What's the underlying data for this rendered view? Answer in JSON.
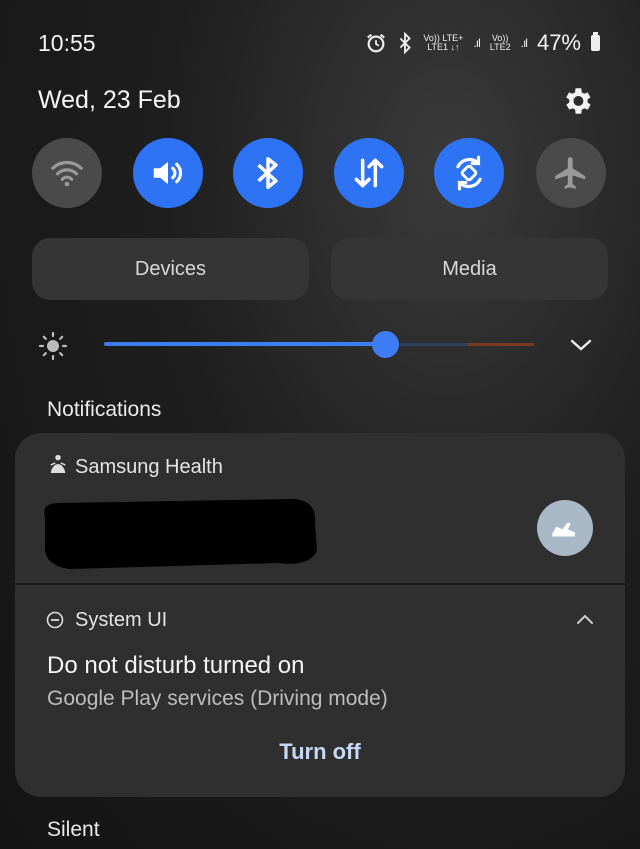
{
  "status_bar": {
    "time": "10:55",
    "sim1_top": "Vo)) LTE+",
    "sim1_bottom": "LTE1 ↓↑",
    "sim2_top": "Vo))",
    "sim2_bottom": "LTE2",
    "battery_percent": "47%",
    "icons": [
      "alarm-icon",
      "bluetooth-icon",
      "signal-icon",
      "battery-icon"
    ]
  },
  "header": {
    "date": "Wed, 23 Feb",
    "settings_icon": "gear-icon"
  },
  "quick_tiles": [
    {
      "name": "wifi",
      "icon": "wifi-icon",
      "state": "off"
    },
    {
      "name": "sound",
      "icon": "speaker-icon",
      "state": "on"
    },
    {
      "name": "bluetooth",
      "icon": "bluetooth-icon",
      "state": "on"
    },
    {
      "name": "mobile-data",
      "icon": "data-arrows-icon",
      "state": "on"
    },
    {
      "name": "auto-rotate",
      "icon": "rotate-icon",
      "state": "on"
    },
    {
      "name": "airplane-mode",
      "icon": "airplane-icon",
      "state": "off"
    }
  ],
  "buttons": {
    "devices": "Devices",
    "media": "Media"
  },
  "brightness": {
    "level": 0.66
  },
  "notifications": {
    "heading": "Notifications",
    "samsung_health": {
      "app": "Samsung Health"
    },
    "system_ui": {
      "app": "System UI",
      "title": "Do not disturb turned on",
      "subtitle": "Google Play services (Driving mode)",
      "action": "Turn off"
    },
    "silent_heading": "Silent"
  },
  "colors": {
    "accent": "#2f73f5",
    "tile_off": "#4a4a4a",
    "card": "#2f2f2f"
  }
}
